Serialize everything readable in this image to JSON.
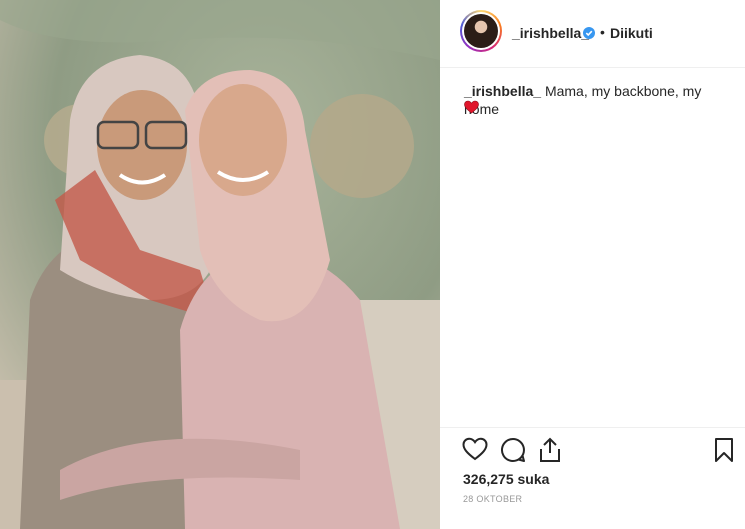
{
  "post": {
    "username": "_irishbella_",
    "follow_status": "Diikuti",
    "separator": "•",
    "caption_user": "_irishbella_",
    "caption_text": "Mama, my backbone, my home",
    "caption_emoji": "red-heart",
    "likes": "326,275 suka",
    "date": "28 OKTOBER"
  },
  "icons": {
    "verified": "verified-badge-icon",
    "like": "heart-outline-icon",
    "comment": "comment-bubble-icon",
    "share": "share-upload-icon",
    "save": "bookmark-icon"
  },
  "colors": {
    "verified": "#3897f0",
    "heart_emoji": "#e0162b",
    "text": "#262626",
    "muted": "#999999"
  }
}
